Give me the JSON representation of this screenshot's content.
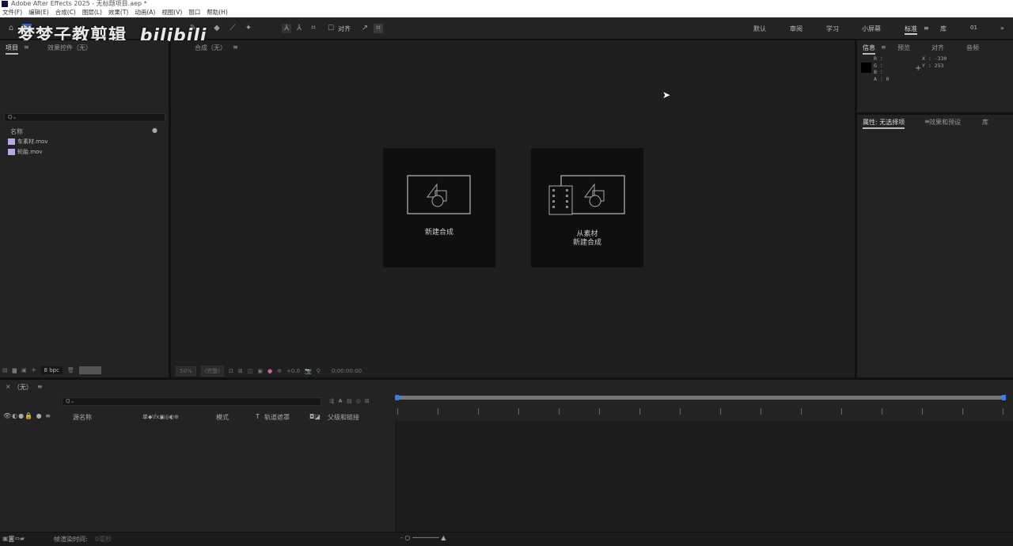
{
  "window": {
    "title": "Adobe After Effects 2025 - 无标题项目.aep *"
  },
  "menu": [
    "文件(F)",
    "编辑(E)",
    "合成(C)",
    "图层(L)",
    "效果(T)",
    "动画(A)",
    "视图(V)",
    "窗口",
    "帮助(H)"
  ],
  "watermark": {
    "text": "梦梦子教剪辑",
    "brand": "bilibili"
  },
  "toolbar": {
    "snap_label": "对齐",
    "workspaces": [
      "默认",
      "审阅",
      "学习",
      "小屏幕",
      "标准",
      "库",
      "01"
    ],
    "active_workspace": "标准",
    "more": "»"
  },
  "project_panel": {
    "tabs": [
      "项目",
      "效果控件（无）"
    ],
    "search_placeholder": "Q⌄",
    "column_name": "名称",
    "files": [
      {
        "name": "车素材.mov"
      },
      {
        "name": "轮胎.mov"
      }
    ],
    "bpc": "8 bpc"
  },
  "composition_panel": {
    "tab": "合成（无）",
    "cards": [
      {
        "label": "新建合成"
      },
      {
        "label_line1": "从素材",
        "label_line2": "新建合成"
      }
    ],
    "zoom": "50%",
    "resolution": "(完整)",
    "exposure": "+0.0",
    "timecode": "0:00:00:00"
  },
  "info_panel": {
    "tabs": [
      "信息",
      "预览",
      "对齐",
      "音频"
    ],
    "r": "R :",
    "g": "G :",
    "b": "B :",
    "a": "A : 0",
    "x": "X : -330",
    "y": "Y : 253"
  },
  "properties_panel": {
    "tabs": [
      "属性: 无选择项",
      "效果和预设",
      "库"
    ]
  },
  "timeline": {
    "tab": "（无）",
    "search_placeholder": "Q⌄",
    "columns": {
      "source_name": "源名称",
      "switches": "单◆\\fx▣◎◐⊕",
      "mode": "模式",
      "trkmat_t": "T",
      "track_matte": "轨道遮罩",
      "parent": "父级和链接"
    }
  },
  "status_bar": {
    "render_time_label": "帧渲染时间:",
    "render_time_value": "0毫秒"
  }
}
